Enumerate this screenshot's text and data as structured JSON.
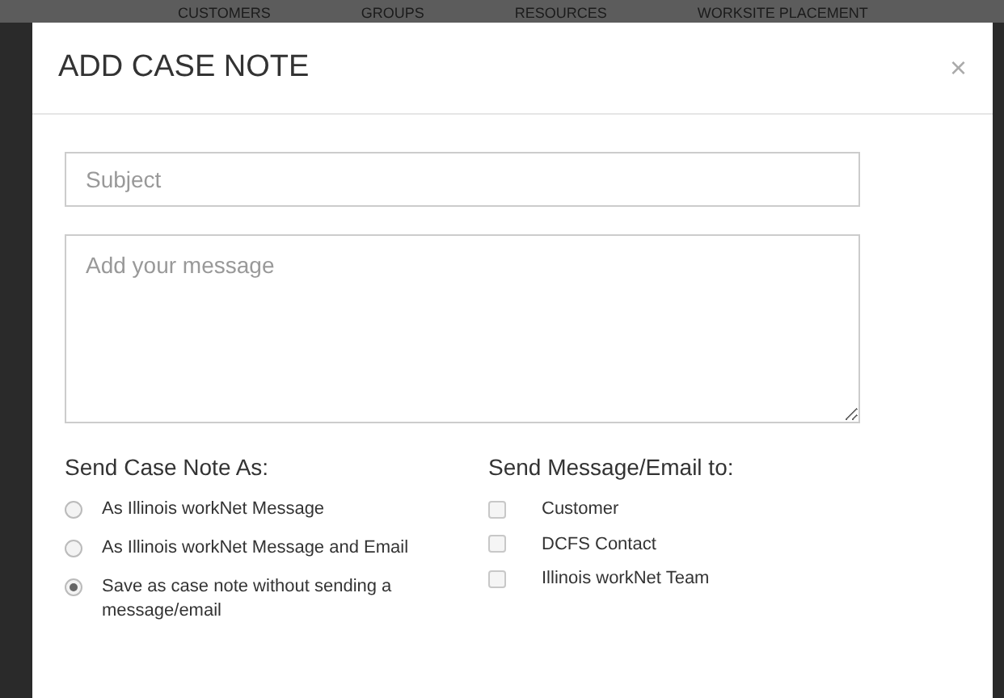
{
  "background_nav": [
    "CUSTOMERS",
    "GROUPS",
    "RESOURCES",
    "WORKSITE PLACEMENT"
  ],
  "dialog": {
    "title": "ADD CASE NOTE",
    "close": "×",
    "subject": {
      "placeholder": "Subject"
    },
    "message": {
      "placeholder": "Add your message"
    },
    "send_as": {
      "heading": "Send Case Note As:",
      "options": [
        {
          "label": "As Illinois workNet Message",
          "selected": false
        },
        {
          "label": "As Illinois workNet Message and Email",
          "selected": false
        },
        {
          "label": "Save as case note without sending a message/email",
          "selected": true
        }
      ]
    },
    "send_to": {
      "heading": "Send Message/Email to:",
      "options": [
        {
          "label": "Customer",
          "checked": false
        },
        {
          "label": "DCFS Contact",
          "checked": false
        },
        {
          "label": "Illinois workNet Team",
          "checked": false
        }
      ]
    }
  }
}
